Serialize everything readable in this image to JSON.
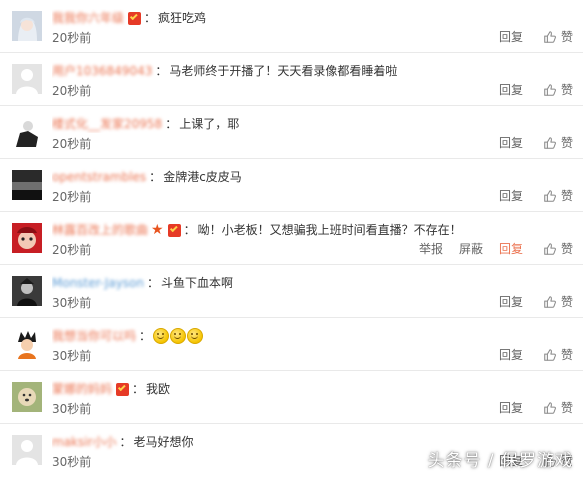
{
  "comments": [
    {
      "username": "我我你六年级",
      "badge": true,
      "star": false,
      "content": "疯狂吃鸡",
      "time": "20秒前",
      "reply": "回复",
      "like": "赞",
      "extra": false,
      "avatar": "anime-girl"
    },
    {
      "username": "用户1036849043",
      "badge": false,
      "star": false,
      "content": "马老师终于开播了！天天看录像都看睡着啦",
      "time": "20秒前",
      "reply": "回复",
      "like": "赞",
      "extra": false,
      "avatar": "default"
    },
    {
      "username": "楼式化__发家20958",
      "badge": false,
      "star": false,
      "content": "上课了，耶",
      "time": "20秒前",
      "reply": "回复",
      "like": "赞",
      "extra": false,
      "avatar": "dark-figure"
    },
    {
      "username": "opentstrambles",
      "badge": false,
      "star": false,
      "content": "金牌港c皮皮马",
      "time": "20秒前",
      "reply": "回复",
      "like": "赞",
      "extra": false,
      "avatar": "landscape"
    },
    {
      "username": "林露百改上的歌曲",
      "badge": true,
      "star": true,
      "content": "呦！小老板！又想骗我上班时间看直播？不存在！",
      "time": "20秒前",
      "reply": "回复",
      "like": "赞",
      "extra": true,
      "report": "举报",
      "block": "屏蔽",
      "avatar": "cartoon-red"
    },
    {
      "username": "Monster-Jayson",
      "badge": false,
      "star": false,
      "content": "斗鱼下血本啊",
      "time": "30秒前",
      "reply": "回复",
      "like": "赞",
      "extra": false,
      "avatar": "dark-char",
      "blue": true
    },
    {
      "username": "我想当你可以吗",
      "badge": false,
      "star": false,
      "content": "",
      "emojis": 3,
      "time": "30秒前",
      "reply": "回复",
      "like": "赞",
      "extra": false,
      "avatar": "goku"
    },
    {
      "username": "蒙娜的妈妈",
      "badge": true,
      "star": false,
      "content": "我欧",
      "time": "30秒前",
      "reply": "回复",
      "like": "赞",
      "extra": false,
      "avatar": "dog"
    },
    {
      "username": "maksir小小",
      "badge": false,
      "star": false,
      "content": "老马好想你",
      "time": "30秒前",
      "reply": "回复",
      "like": "赞",
      "extra": false,
      "avatar": "default"
    }
  ],
  "colon": "：",
  "watermark": "头条号 / 保罗游戏",
  "colors": {
    "username": "#eb7350",
    "accent": "#eb7350",
    "text": "#333333",
    "muted": "#666666",
    "badge": "#e63a26"
  }
}
